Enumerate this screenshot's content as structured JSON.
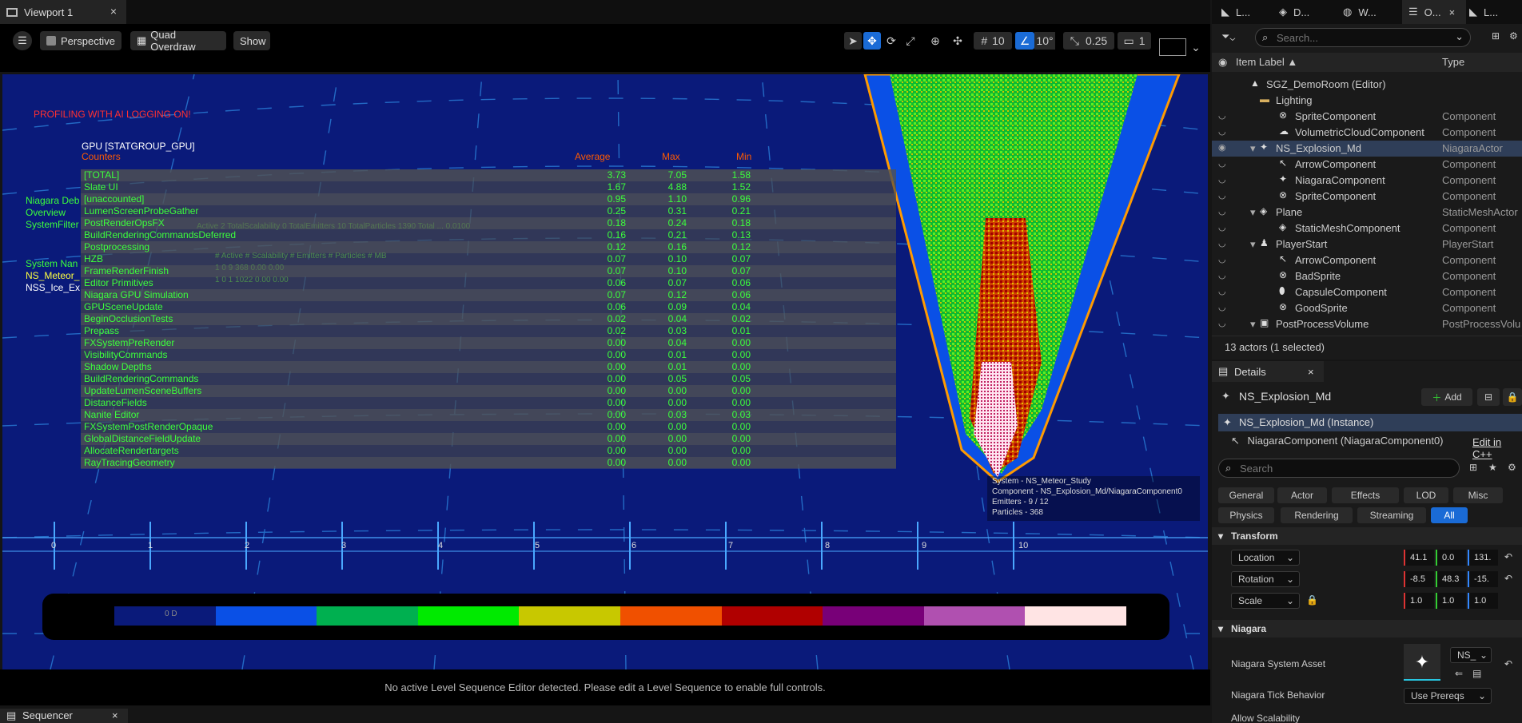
{
  "viewport_tab": {
    "title": "Viewport 1",
    "close": "×"
  },
  "toolbar": {
    "menu": "☰",
    "perspective": "Perspective",
    "view_mode": "Quad Overdraw",
    "show": "Show",
    "grid_size": "10",
    "rotation_snap": "10°",
    "scale_snap": "0.25",
    "camera_speed": "1"
  },
  "hud": {
    "profiling": "PROFILING WITH AI LOGGING ON!",
    "niagara_debug": [
      "Niagara Deb",
      "Overview",
      "SystemFilter"
    ],
    "system_name_header": "System Nan",
    "systems": [
      "NS_Meteor_",
      "NSS_Ice_Ex"
    ],
    "bg_stats_line": "Active  2  TotalScalability  0  TotalEmitters  10  TotalParticles  1390  Total ... 0.0100",
    "bg_table_header": "# Active      # Scalability      # Emitters      # Particles      # MB",
    "bg_table_rows": [
      "1        0        9        368        0.00  0.00",
      "1        0        1        1022       0.00  0.00"
    ],
    "gpu_title": "GPU [STATGROUP_GPU]",
    "col_counters": "Counters",
    "col_average": "Average",
    "col_max": "Max",
    "col_min": "Min",
    "status_message": "No active Level Sequence Editor detected. Please edit a Level Sequence to enable full controls."
  },
  "gpu_stats": [
    {
      "name": "[TOTAL]",
      "avg": "3.73",
      "max": "7.05",
      "min": "1.58"
    },
    {
      "name": "Slate UI",
      "avg": "1.67",
      "max": "4.88",
      "min": "1.52"
    },
    {
      "name": "[unaccounted]",
      "avg": "0.95",
      "max": "1.10",
      "min": "0.96"
    },
    {
      "name": "LumenScreenProbeGather",
      "avg": "0.25",
      "max": "0.31",
      "min": "0.21"
    },
    {
      "name": "PostRenderOpsFX",
      "avg": "0.18",
      "max": "0.24",
      "min": "0.18"
    },
    {
      "name": "BuildRenderingCommandsDeferred",
      "avg": "0.16",
      "max": "0.21",
      "min": "0.13"
    },
    {
      "name": "Postprocessing",
      "avg": "0.12",
      "max": "0.16",
      "min": "0.12"
    },
    {
      "name": "HZB",
      "avg": "0.07",
      "max": "0.10",
      "min": "0.07"
    },
    {
      "name": "FrameRenderFinish",
      "avg": "0.07",
      "max": "0.10",
      "min": "0.07"
    },
    {
      "name": "Editor Primitives",
      "avg": "0.06",
      "max": "0.07",
      "min": "0.06"
    },
    {
      "name": "Niagara GPU Simulation",
      "avg": "0.07",
      "max": "0.12",
      "min": "0.06"
    },
    {
      "name": "GPUSceneUpdate",
      "avg": "0.06",
      "max": "0.09",
      "min": "0.04"
    },
    {
      "name": "BeginOcclusionTests",
      "avg": "0.02",
      "max": "0.04",
      "min": "0.02"
    },
    {
      "name": "Prepass",
      "avg": "0.02",
      "max": "0.03",
      "min": "0.01"
    },
    {
      "name": "FXSystemPreRender",
      "avg": "0.00",
      "max": "0.04",
      "min": "0.00"
    },
    {
      "name": "VisibilityCommands",
      "avg": "0.00",
      "max": "0.01",
      "min": "0.00"
    },
    {
      "name": "Shadow Depths",
      "avg": "0.00",
      "max": "0.01",
      "min": "0.00"
    },
    {
      "name": "BuildRenderingCommands",
      "avg": "0.00",
      "max": "0.05",
      "min": "0.05"
    },
    {
      "name": "UpdateLumenSceneBuffers",
      "avg": "0.00",
      "max": "0.00",
      "min": "0.00"
    },
    {
      "name": "DistanceFields",
      "avg": "0.00",
      "max": "0.00",
      "min": "0.00"
    },
    {
      "name": "Nanite Editor",
      "avg": "0.00",
      "max": "0.03",
      "min": "0.03"
    },
    {
      "name": "FXSystemPostRenderOpaque",
      "avg": "0.00",
      "max": "0.00",
      "min": "0.00"
    },
    {
      "name": "GlobalDistanceFieldUpdate",
      "avg": "0.00",
      "max": "0.00",
      "min": "0.00"
    },
    {
      "name": "AllocateRendertargets",
      "avg": "0.00",
      "max": "0.00",
      "min": "0.00"
    },
    {
      "name": "RayTracingGeometry",
      "avg": "0.00",
      "max": "0.00",
      "min": "0.00"
    }
  ],
  "axis_numbers": [
    "0",
    "1",
    "2",
    "3",
    "4",
    "5",
    "6",
    "7",
    "8",
    "9",
    "10"
  ],
  "overdraw_legend": {
    "label": "0 D",
    "colors": [
      "#0a1a7a",
      "#0a50e6",
      "#00b050",
      "#00ea00",
      "#c8c800",
      "#f05000",
      "#b00000",
      "#780078",
      "#b050b0",
      "#ffe4e4"
    ]
  },
  "tooltip": {
    "line1": "System - NS_Meteor_Study",
    "line2": "Component - NS_Explosion_Md/NiagaraComponent0",
    "line3": "Emitters - 9 / 12",
    "line4": "Particles - 368"
  },
  "sequencer_tab": "Sequencer",
  "right_tabs": [
    "L...",
    "D...",
    "W...",
    "O...",
    "L..."
  ],
  "outliner": {
    "search_placeholder": "Search...",
    "col_label": "Item Label ▲",
    "col_type": "Type",
    "footer": "13 actors (1 selected)",
    "rows": [
      {
        "label": "SGZ_DemoRoom (Editor)",
        "type": "",
        "indent": 0,
        "icon": "level-icon",
        "glyph": "▲"
      },
      {
        "label": "Lighting",
        "type": "",
        "indent": 1,
        "icon": "folder-icon",
        "glyph": "▬"
      },
      {
        "label": "SpriteComponent",
        "type": "Component",
        "indent": 3,
        "icon": "sprite-icon",
        "glyph": "⊗"
      },
      {
        "label": "VolumetricCloudComponent",
        "type": "Component",
        "indent": 3,
        "icon": "cloud-icon",
        "glyph": "☁"
      },
      {
        "label": "NS_Explosion_Md",
        "type": "NiagaraActor",
        "indent": 2,
        "icon": "niagara-icon",
        "glyph": "✦",
        "selected": true
      },
      {
        "label": "ArrowComponent",
        "type": "Component",
        "indent": 3,
        "icon": "arrow-icon",
        "glyph": "↖"
      },
      {
        "label": "NiagaraComponent",
        "type": "Component",
        "indent": 3,
        "icon": "niagara-icon",
        "glyph": "✦"
      },
      {
        "label": "SpriteComponent",
        "type": "Component",
        "indent": 3,
        "icon": "sprite-icon",
        "glyph": "⊗"
      },
      {
        "label": "Plane",
        "type": "StaticMeshActor",
        "indent": 2,
        "icon": "mesh-icon",
        "glyph": "◈"
      },
      {
        "label": "StaticMeshComponent",
        "type": "Component",
        "indent": 3,
        "icon": "mesh-icon",
        "glyph": "◈"
      },
      {
        "label": "PlayerStart",
        "type": "PlayerStart",
        "indent": 2,
        "icon": "player-icon",
        "glyph": "♟"
      },
      {
        "label": "ArrowComponent",
        "type": "Component",
        "indent": 3,
        "icon": "arrow-icon",
        "glyph": "↖"
      },
      {
        "label": "BadSprite",
        "type": "Component",
        "indent": 3,
        "icon": "sprite-icon",
        "glyph": "⊗"
      },
      {
        "label": "CapsuleComponent",
        "type": "Component",
        "indent": 3,
        "icon": "capsule-icon",
        "glyph": "⬮"
      },
      {
        "label": "GoodSprite",
        "type": "Component",
        "indent": 3,
        "icon": "sprite-icon",
        "glyph": "⊗"
      },
      {
        "label": "PostProcessVolume",
        "type": "PostProcessVolu",
        "indent": 2,
        "icon": "volume-icon",
        "glyph": "▣"
      }
    ]
  },
  "details": {
    "tab": "Details",
    "actor_name": "NS_Explosion_Md",
    "add_label": "Add",
    "instance_label": "NS_Explosion_Md (Instance)",
    "component_label": "NiagaraComponent (NiagaraComponent0)",
    "edit_in_cpp": "Edit in C++",
    "search_placeholder": "Search",
    "filters_row1": [
      "General",
      "Actor",
      "Effects",
      "LOD",
      "Misc"
    ],
    "filters_row2": [
      "Physics",
      "Rendering",
      "Streaming",
      "All"
    ],
    "transform_section": "Transform",
    "location_label": "Location",
    "location": [
      "41.1",
      "0.0",
      "131."
    ],
    "rotation_label": "Rotation",
    "rotation": [
      "-8.5",
      "48.3",
      "-15."
    ],
    "scale_label": "Scale",
    "scale": [
      "1.0",
      "1.0",
      "1.0"
    ],
    "niagara_section": "Niagara",
    "system_asset_label": "Niagara System Asset",
    "system_asset_value": "NS_",
    "tick_behavior_label": "Niagara Tick Behavior",
    "tick_behavior_value": "Use Prereqs",
    "cutoff_label": "Allow Scalability"
  }
}
